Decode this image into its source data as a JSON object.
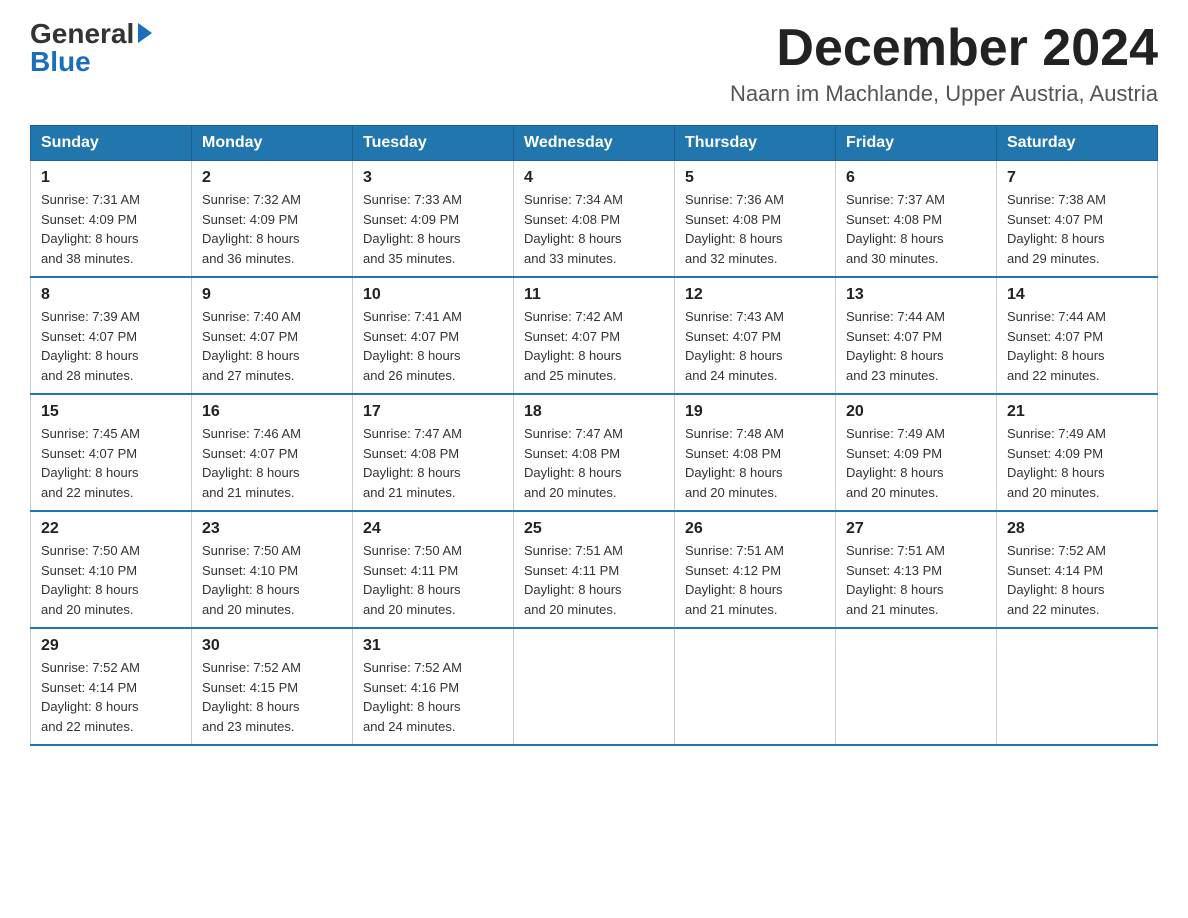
{
  "header": {
    "logo_general": "General",
    "logo_blue": "Blue",
    "month_title": "December 2024",
    "location": "Naarn im Machlande, Upper Austria, Austria"
  },
  "days_of_week": [
    "Sunday",
    "Monday",
    "Tuesday",
    "Wednesday",
    "Thursday",
    "Friday",
    "Saturday"
  ],
  "weeks": [
    [
      {
        "day": "1",
        "sunrise": "7:31 AM",
        "sunset": "4:09 PM",
        "daylight": "8 hours and 38 minutes."
      },
      {
        "day": "2",
        "sunrise": "7:32 AM",
        "sunset": "4:09 PM",
        "daylight": "8 hours and 36 minutes."
      },
      {
        "day": "3",
        "sunrise": "7:33 AM",
        "sunset": "4:09 PM",
        "daylight": "8 hours and 35 minutes."
      },
      {
        "day": "4",
        "sunrise": "7:34 AM",
        "sunset": "4:08 PM",
        "daylight": "8 hours and 33 minutes."
      },
      {
        "day": "5",
        "sunrise": "7:36 AM",
        "sunset": "4:08 PM",
        "daylight": "8 hours and 32 minutes."
      },
      {
        "day": "6",
        "sunrise": "7:37 AM",
        "sunset": "4:08 PM",
        "daylight": "8 hours and 30 minutes."
      },
      {
        "day": "7",
        "sunrise": "7:38 AM",
        "sunset": "4:07 PM",
        "daylight": "8 hours and 29 minutes."
      }
    ],
    [
      {
        "day": "8",
        "sunrise": "7:39 AM",
        "sunset": "4:07 PM",
        "daylight": "8 hours and 28 minutes."
      },
      {
        "day": "9",
        "sunrise": "7:40 AM",
        "sunset": "4:07 PM",
        "daylight": "8 hours and 27 minutes."
      },
      {
        "day": "10",
        "sunrise": "7:41 AM",
        "sunset": "4:07 PM",
        "daylight": "8 hours and 26 minutes."
      },
      {
        "day": "11",
        "sunrise": "7:42 AM",
        "sunset": "4:07 PM",
        "daylight": "8 hours and 25 minutes."
      },
      {
        "day": "12",
        "sunrise": "7:43 AM",
        "sunset": "4:07 PM",
        "daylight": "8 hours and 24 minutes."
      },
      {
        "day": "13",
        "sunrise": "7:44 AM",
        "sunset": "4:07 PM",
        "daylight": "8 hours and 23 minutes."
      },
      {
        "day": "14",
        "sunrise": "7:44 AM",
        "sunset": "4:07 PM",
        "daylight": "8 hours and 22 minutes."
      }
    ],
    [
      {
        "day": "15",
        "sunrise": "7:45 AM",
        "sunset": "4:07 PM",
        "daylight": "8 hours and 22 minutes."
      },
      {
        "day": "16",
        "sunrise": "7:46 AM",
        "sunset": "4:07 PM",
        "daylight": "8 hours and 21 minutes."
      },
      {
        "day": "17",
        "sunrise": "7:47 AM",
        "sunset": "4:08 PM",
        "daylight": "8 hours and 21 minutes."
      },
      {
        "day": "18",
        "sunrise": "7:47 AM",
        "sunset": "4:08 PM",
        "daylight": "8 hours and 20 minutes."
      },
      {
        "day": "19",
        "sunrise": "7:48 AM",
        "sunset": "4:08 PM",
        "daylight": "8 hours and 20 minutes."
      },
      {
        "day": "20",
        "sunrise": "7:49 AM",
        "sunset": "4:09 PM",
        "daylight": "8 hours and 20 minutes."
      },
      {
        "day": "21",
        "sunrise": "7:49 AM",
        "sunset": "4:09 PM",
        "daylight": "8 hours and 20 minutes."
      }
    ],
    [
      {
        "day": "22",
        "sunrise": "7:50 AM",
        "sunset": "4:10 PM",
        "daylight": "8 hours and 20 minutes."
      },
      {
        "day": "23",
        "sunrise": "7:50 AM",
        "sunset": "4:10 PM",
        "daylight": "8 hours and 20 minutes."
      },
      {
        "day": "24",
        "sunrise": "7:50 AM",
        "sunset": "4:11 PM",
        "daylight": "8 hours and 20 minutes."
      },
      {
        "day": "25",
        "sunrise": "7:51 AM",
        "sunset": "4:11 PM",
        "daylight": "8 hours and 20 minutes."
      },
      {
        "day": "26",
        "sunrise": "7:51 AM",
        "sunset": "4:12 PM",
        "daylight": "8 hours and 21 minutes."
      },
      {
        "day": "27",
        "sunrise": "7:51 AM",
        "sunset": "4:13 PM",
        "daylight": "8 hours and 21 minutes."
      },
      {
        "day": "28",
        "sunrise": "7:52 AM",
        "sunset": "4:14 PM",
        "daylight": "8 hours and 22 minutes."
      }
    ],
    [
      {
        "day": "29",
        "sunrise": "7:52 AM",
        "sunset": "4:14 PM",
        "daylight": "8 hours and 22 minutes."
      },
      {
        "day": "30",
        "sunrise": "7:52 AM",
        "sunset": "4:15 PM",
        "daylight": "8 hours and 23 minutes."
      },
      {
        "day": "31",
        "sunrise": "7:52 AM",
        "sunset": "4:16 PM",
        "daylight": "8 hours and 24 minutes."
      },
      null,
      null,
      null,
      null
    ]
  ],
  "labels": {
    "sunrise": "Sunrise:",
    "sunset": "Sunset:",
    "daylight": "Daylight:"
  }
}
